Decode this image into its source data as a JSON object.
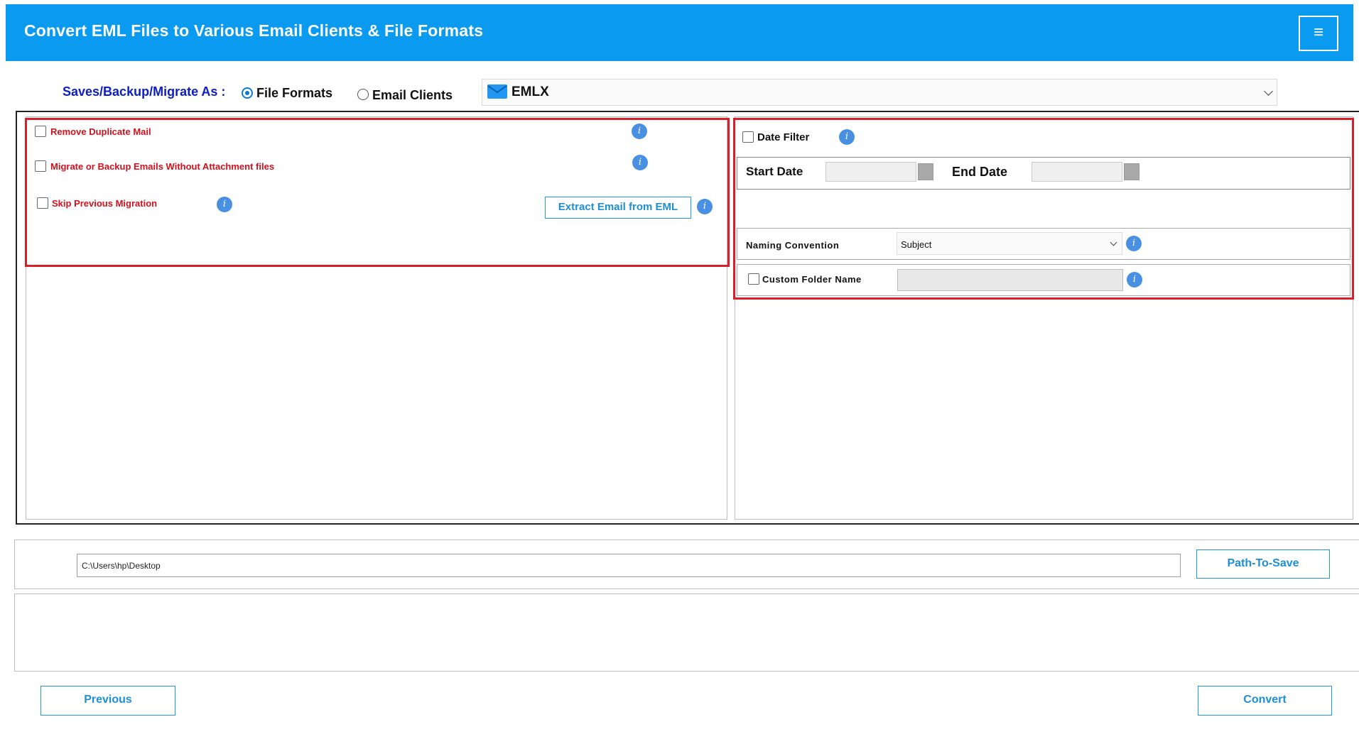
{
  "header": {
    "title": "Convert EML Files to Various Email Clients & File Formats",
    "menu_icon": "hamburger-icon",
    "menu_glyph": "≡",
    "bg_color": "#0a9bf0"
  },
  "save_as": {
    "label": "Saves/Backup/Migrate As :",
    "options": [
      {
        "label": "File Formats",
        "selected": true
      },
      {
        "label": "Email Clients",
        "selected": false
      }
    ],
    "format_icon": "mail-icon",
    "format_value": "EMLX"
  },
  "left_options": {
    "remove_duplicate": "Remove Duplicate Mail",
    "without_attachment": "Migrate or Backup Emails Without Attachment files",
    "skip_previous": "Skip Previous Migration",
    "extract_button": "Extract Email from EML",
    "info_glyph": "i"
  },
  "right_options": {
    "date_filter": "Date Filter",
    "start_date_label": "Start Date",
    "end_date_label": "End Date",
    "naming_label": "Naming Convention",
    "naming_value": "Subject",
    "custom_folder_label": "Custom Folder Name"
  },
  "path": {
    "value": "C:\\Users\\hp\\Desktop",
    "button": "Path-To-Save"
  },
  "footer": {
    "previous": "Previous",
    "convert": "Convert"
  },
  "colors": {
    "accent": "#0a9bf0",
    "highlight_red": "#d81f2a",
    "label_blue": "#0c1ec4",
    "option_red": "#d0111d"
  }
}
